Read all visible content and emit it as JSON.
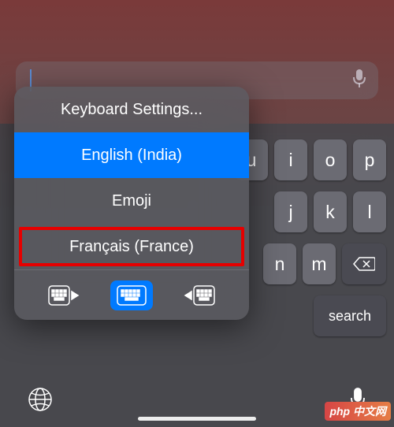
{
  "search": {
    "value": "",
    "placeholder": ""
  },
  "keyboard": {
    "row1": [
      "u",
      "i",
      "o",
      "p"
    ],
    "row2": [
      "j",
      "k",
      "l"
    ],
    "row3": [
      "n",
      "m"
    ],
    "search_label": "search"
  },
  "popup": {
    "settings_label": "Keyboard Settings...",
    "languages": [
      {
        "label": "English (India)",
        "selected": true,
        "highlighted": false
      },
      {
        "label": "Emoji",
        "selected": false,
        "highlighted": false
      },
      {
        "label": "Français (France)",
        "selected": false,
        "highlighted": true
      }
    ]
  },
  "watermark": "php 中文网"
}
